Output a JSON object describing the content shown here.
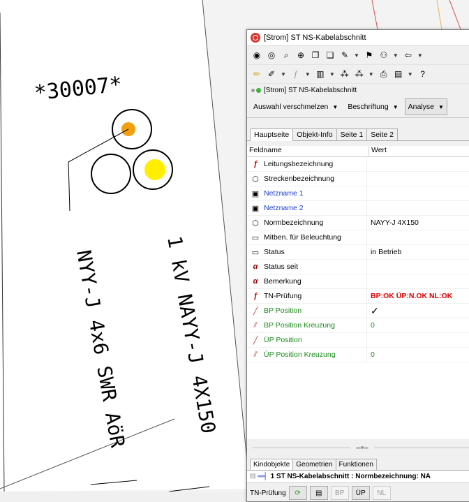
{
  "map": {
    "label_number": "*30007*",
    "cable_label_1": "NYY-J 4x6 SWR AöR",
    "cable_label_2": "1 kV NAYY-J 4X150",
    "colors": {
      "paper": "#ffffff",
      "orange_dot": "#f0a010",
      "yellow_dot": "#ffee00",
      "red_line": "#d05050"
    }
  },
  "window": {
    "title": "[Strom] ST NS-Kabelabschnitt",
    "status_text": "[Strom] ST NS-Kabelabschnitt",
    "dropdowns": {
      "merge_label": "Auswahl verschmelzen",
      "labeling_label": "Beschriftung",
      "analysis_label": "Analyse"
    },
    "tabs": [
      "Hauptseite",
      "Objekt-Info",
      "Seite 1",
      "Seite 2"
    ],
    "grid": {
      "col_field": "Feldname",
      "col_value": "Wert",
      "rows": [
        {
          "name": "Leitungsbezeichnung",
          "value": "",
          "icon": "function-icon"
        },
        {
          "name": "Streckenbezeichnung",
          "value": "",
          "icon": "cube-icon"
        },
        {
          "name": "Netzname 1",
          "value": "",
          "icon": "book-icon"
        },
        {
          "name": "Netzname 2",
          "value": "",
          "icon": "book-icon"
        },
        {
          "name": "Normbezeichnung",
          "value": "NAYY-J 4X150",
          "icon": "cube-icon"
        },
        {
          "name": "Mitben. für Beleuchtung",
          "value": "",
          "icon": "table-icon"
        },
        {
          "name": "Status",
          "value": "in Betrieb",
          "icon": "table-icon"
        },
        {
          "name": "Status seit",
          "value": "",
          "icon": "alpha-icon"
        },
        {
          "name": "Bemerkung",
          "value": "",
          "icon": "alpha-icon"
        },
        {
          "name": "TN-Prüfung",
          "value": "BP:OK ÜP:N.OK  NL:OK",
          "icon": "function-icon"
        },
        {
          "name": "BP Position",
          "value": "✓",
          "icon": "line-icon"
        },
        {
          "name": "BP Position Kreuzung",
          "value": "0",
          "icon": "cross-line-icon"
        },
        {
          "name": "ÜP Position",
          "value": "",
          "icon": "line-icon"
        },
        {
          "name": "ÜP Position Kreuzung",
          "value": "0",
          "icon": "cross-line-icon"
        }
      ]
    },
    "bottom_tabs": [
      "Kindobjekte",
      "Geometrien",
      "Funktionen"
    ],
    "child_row": "1 ST NS-Kabelabschnitt :  Normbezeichnung: NA",
    "tn_bar": {
      "label": "TN-Prüfung",
      "bp": "BP",
      "up": "ÜP",
      "nl": "NL"
    }
  }
}
